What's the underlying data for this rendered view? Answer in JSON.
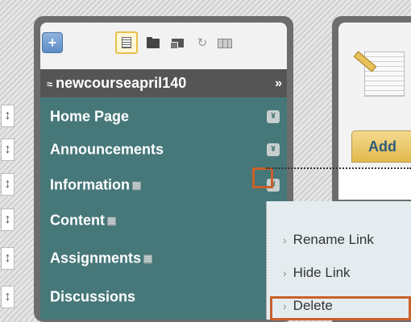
{
  "toolbar": {
    "add_icon": "plus-icon",
    "icons": [
      "list-view-icon",
      "folder-icon",
      "window-icon",
      "refresh-icon",
      "grid-icon"
    ]
  },
  "course": {
    "name": "newcourseapril140",
    "collapse_glyph": "≈",
    "expand_glyph": "»"
  },
  "menu": {
    "items": [
      {
        "label": "Home Page",
        "hidden": false,
        "has_dropdown": true
      },
      {
        "label": "Announcements",
        "hidden": false,
        "has_dropdown": true
      },
      {
        "label": "Information",
        "hidden": true,
        "has_dropdown": true,
        "active_dropdown": true
      },
      {
        "label": "Content",
        "hidden": true,
        "has_dropdown": false
      },
      {
        "label": "Assignments",
        "hidden": true,
        "has_dropdown": false
      },
      {
        "label": "Discussions",
        "hidden": false,
        "has_dropdown": false
      }
    ],
    "dropdown_glyph": "¥",
    "handle_glyph": "↕"
  },
  "right_panel": {
    "add_button": "Add"
  },
  "context_menu": {
    "items": [
      {
        "label": "Rename Link"
      },
      {
        "label": "Hide Link"
      },
      {
        "label": "Delete",
        "highlighted": true
      }
    ],
    "arrow_glyph": "›"
  },
  "colors": {
    "menu_bg": "#467779",
    "course_bar": "#555555",
    "highlight": "#c9602a",
    "context_bg": "#e5ecef"
  }
}
